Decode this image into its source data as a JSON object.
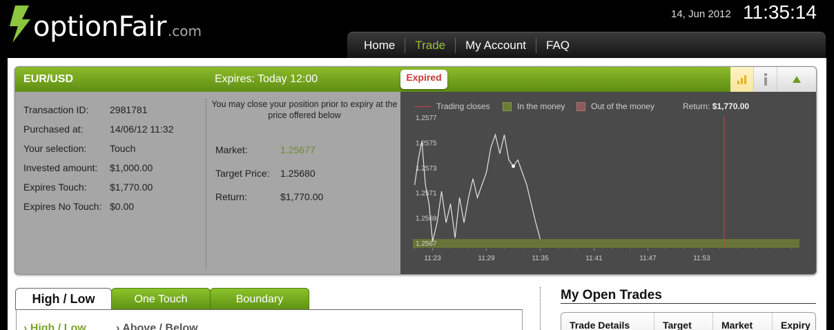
{
  "header": {
    "logo_text": "optionFair",
    "logo_suffix": ".com",
    "date": "14, Jun 2012",
    "time": "11:35:14"
  },
  "nav": {
    "items": [
      "Home",
      "Trade",
      "My Account",
      "FAQ"
    ],
    "active": "Trade"
  },
  "trade_panel": {
    "pair": "EUR/USD",
    "expires": "Expires:  Today 12:00",
    "status": "Expired",
    "details": [
      {
        "label": "Transaction ID:",
        "value": "2981781"
      },
      {
        "label": "Purchased at:",
        "value": "14/06/12 11:32"
      },
      {
        "label": "Your selection:",
        "value": "Touch"
      },
      {
        "label": "Invested amount:",
        "value": "$1,000.00"
      },
      {
        "label": "Expires Touch:",
        "value": "$1,770.00"
      },
      {
        "label": "Expires No Touch:",
        "value": "$0.00"
      }
    ],
    "close_note": "You may close your position prior to expiry at the price offered below",
    "market_label": "Market:",
    "market_value": "1.25677",
    "target_label": "Target Price:",
    "target_value": "1.25680",
    "return_label": "Return:",
    "return_value": "$1,770.00"
  },
  "chart_data": {
    "type": "line",
    "legend": {
      "trading_closes": "Trading closes",
      "in_money": "In the money",
      "out_money": "Out of the money",
      "return_label": "Return:",
      "return_value": "$1,770.00"
    },
    "y_ticks": [
      "1.2577",
      "1.2575",
      "1.2573",
      "1.2571",
      "1.2569",
      "1.2567"
    ],
    "x_ticks": [
      "11:23",
      "11:29",
      "11:35",
      "11:41",
      "11:47",
      "11:53"
    ],
    "ylim": [
      1.2567,
      1.2577
    ],
    "xlim_minutes": [
      20.8,
      63.9
    ],
    "in_money_band": [
      1.2567,
      1.25677
    ],
    "trading_close_minute": 55.5,
    "series": [
      {
        "x": [
          21.0,
          21.4,
          21.8,
          22.2,
          22.6,
          23.0,
          23.5,
          24.0,
          24.5,
          25.0,
          25.5,
          26.0,
          26.5,
          27.0,
          27.5,
          28.0,
          28.5,
          29.0,
          29.5,
          30.0,
          30.5,
          31.0,
          31.5,
          32.0,
          32.5,
          33.0,
          33.5,
          34.0,
          34.5,
          35.0
        ],
        "y": [
          1.2572,
          1.2574,
          1.25755,
          1.2572,
          1.25705,
          1.25675,
          1.2569,
          1.25715,
          1.2569,
          1.25705,
          1.25678,
          1.2571,
          1.2569,
          1.2571,
          1.25725,
          1.2571,
          1.2572,
          1.2573,
          1.2575,
          1.2576,
          1.25745,
          1.2576,
          1.2574,
          1.25735,
          1.2574,
          1.2573,
          1.2572,
          1.25705,
          1.2569,
          1.25677
        ]
      }
    ]
  },
  "lower": {
    "tabs": [
      "High / Low",
      "One Touch",
      "Boundary"
    ],
    "subtabs": [
      "High / Low",
      "Above / Below"
    ],
    "open_trades_title": "My Open Trades",
    "open_trades_columns": [
      "Trade Details",
      "Target",
      "Market",
      "Expiry"
    ]
  },
  "colors": {
    "brand_green": "#7ab51d",
    "active_nav": "#9bc23a",
    "expired_red": "#c73636",
    "chart_bg": "#4a4a4a",
    "in_money": "#6b7d34",
    "out_money": "#8b5a5a"
  }
}
